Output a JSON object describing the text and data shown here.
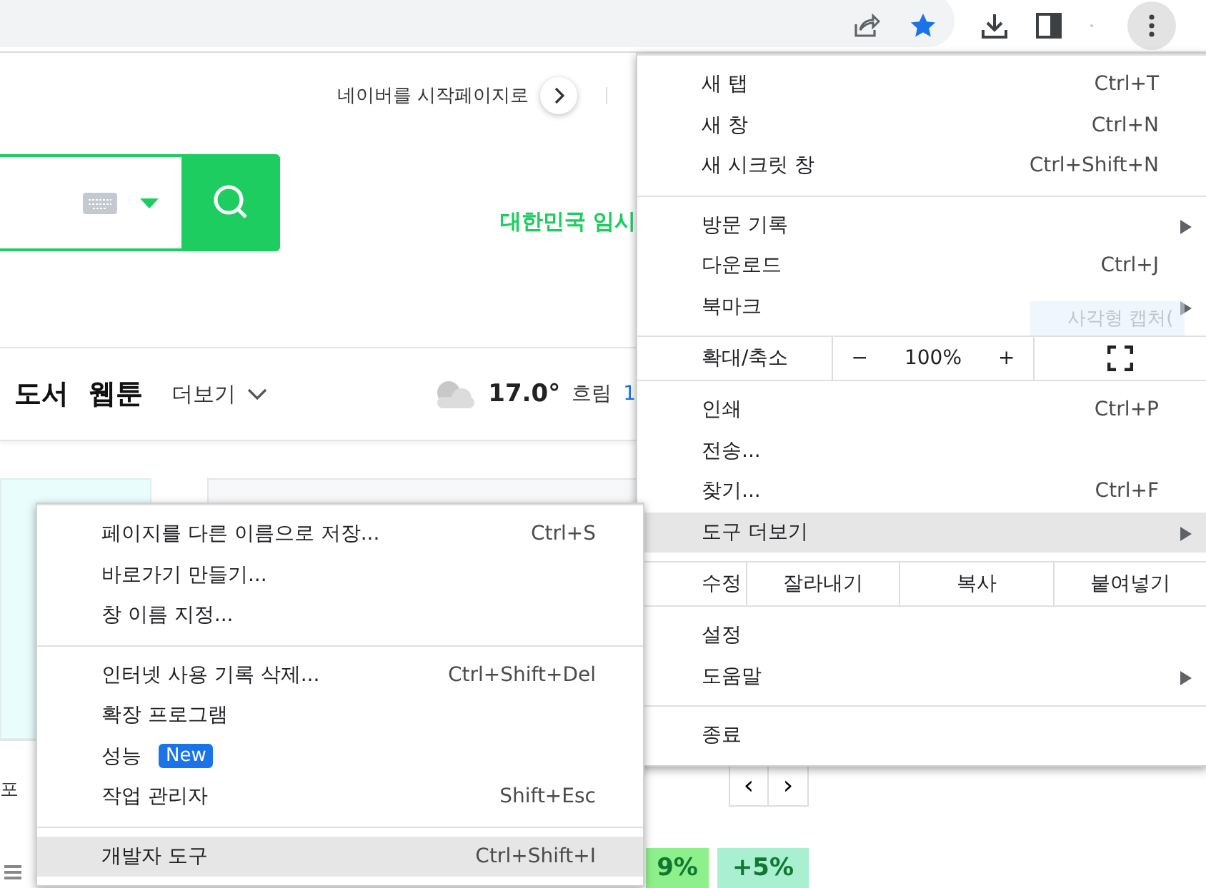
{
  "page": {
    "start_page_link": "네이버를 시작페이지로",
    "notice_text": "대한민국 임시",
    "nav_items": [
      "도서",
      "웹툰"
    ],
    "more_label": "더보기",
    "weather": {
      "temperature": "17.0°",
      "condition": "흐림",
      "extra": "1"
    },
    "side_fragment": "포",
    "pager": [
      "‹",
      "›"
    ],
    "tiles": [
      {
        "text": "9%",
        "color": "#8ef08a"
      },
      {
        "text": "+5%",
        "color": "#a8f0d0"
      }
    ]
  },
  "tooltip": "사각형 캡처(",
  "menu": {
    "sections": [
      [
        {
          "kind": "item",
          "label": "새 탭",
          "shortcut": "Ctrl+T",
          "submenu": false,
          "highlighted": false
        },
        {
          "kind": "item",
          "label": "새 창",
          "shortcut": "Ctrl+N",
          "submenu": false,
          "highlighted": false
        },
        {
          "kind": "item",
          "label": "새 시크릿 창",
          "shortcut": "Ctrl+Shift+N",
          "submenu": false,
          "highlighted": false
        }
      ],
      [
        {
          "kind": "item",
          "label": "방문 기록",
          "submenu": true,
          "highlighted": false
        },
        {
          "kind": "item",
          "label": "다운로드",
          "shortcut": "Ctrl+J",
          "submenu": false,
          "highlighted": false
        },
        {
          "kind": "item",
          "label": "북마크",
          "submenu": true,
          "highlighted": false
        }
      ],
      [
        {
          "kind": "zoom",
          "label": "확대/축소",
          "minus": "−",
          "value": "100%",
          "plus": "+"
        }
      ],
      [
        {
          "kind": "item",
          "label": "인쇄",
          "shortcut": "Ctrl+P",
          "submenu": false,
          "highlighted": false
        },
        {
          "kind": "item",
          "label": "전송...",
          "submenu": false,
          "highlighted": false
        },
        {
          "kind": "item",
          "label": "찾기...",
          "shortcut": "Ctrl+F",
          "submenu": false,
          "highlighted": false
        },
        {
          "kind": "item",
          "label": "도구 더보기",
          "submenu": true,
          "highlighted": true
        }
      ],
      [
        {
          "kind": "edit",
          "label": "수정",
          "buttons": [
            "잘라내기",
            "복사",
            "붙여넣기"
          ]
        }
      ],
      [
        {
          "kind": "item",
          "label": "설정",
          "submenu": false,
          "highlighted": false
        },
        {
          "kind": "item",
          "label": "도움말",
          "submenu": true,
          "highlighted": false
        }
      ],
      [
        {
          "kind": "item",
          "label": "종료",
          "submenu": false,
          "highlighted": false
        }
      ]
    ]
  },
  "submenu": {
    "sections": [
      [
        {
          "kind": "item",
          "label": "페이지를 다른 이름으로 저장...",
          "shortcut": "Ctrl+S",
          "submenu": false,
          "highlighted": false
        },
        {
          "kind": "item",
          "label": "바로가기 만들기...",
          "submenu": false,
          "highlighted": false
        },
        {
          "kind": "item",
          "label": "창 이름 지정...",
          "submenu": false,
          "highlighted": false
        }
      ],
      [
        {
          "kind": "item",
          "label": "인터넷 사용 기록 삭제...",
          "shortcut": "Ctrl+Shift+Del",
          "submenu": false,
          "highlighted": false
        },
        {
          "kind": "item",
          "label": "확장 프로그램",
          "submenu": false,
          "highlighted": false
        },
        {
          "kind": "item",
          "label": "성능",
          "badge": "New",
          "submenu": false,
          "highlighted": false
        },
        {
          "kind": "item",
          "label": "작업 관리자",
          "shortcut": "Shift+Esc",
          "submenu": false,
          "highlighted": false
        }
      ],
      [
        {
          "kind": "item",
          "label": "개발자 도구",
          "shortcut": "Ctrl+Shift+I",
          "submenu": false,
          "highlighted": true
        }
      ]
    ]
  }
}
